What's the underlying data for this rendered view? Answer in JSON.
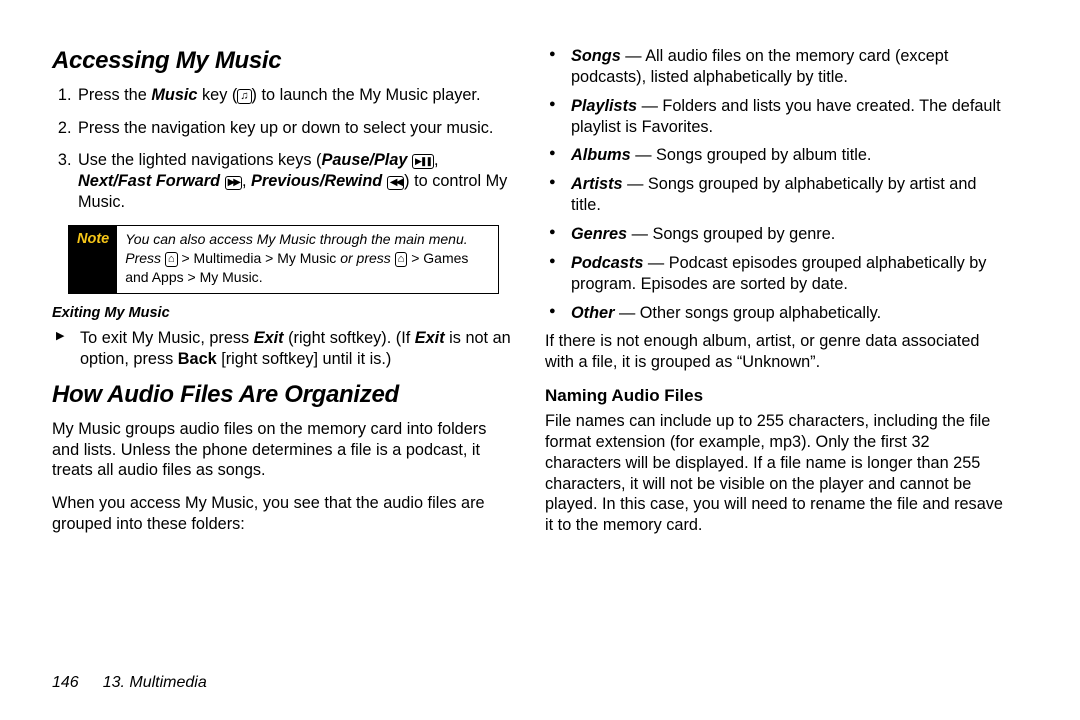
{
  "col1": {
    "h1": "Accessing My Music",
    "step1_a": "Press the ",
    "step1_b": "Music",
    "step1_c": " key (",
    "step1_d": ") to launch the My Music player.",
    "step2": "Press the navigation key up or down to select your music.",
    "step3_a": "Use the lighted navigations keys (",
    "step3_b": "Pause/Play",
    "step3_c": ", ",
    "step3_d": "Next/Fast Forward",
    "step3_e": ", ",
    "step3_f": "Previous/Rewind",
    "step3_g": ") to control My Music.",
    "note_label": "Note",
    "note_a": "You can also access My Music through the main menu. Press ",
    "note_b": " > ",
    "note_c": "Multimedia > My Music",
    "note_d": " or press ",
    "note_e": " > ",
    "note_f": "Games and Apps > My Music",
    "note_g": ".",
    "exit_h": "Exiting My Music",
    "exit_a": "To exit My Music, press ",
    "exit_b": "Exit",
    "exit_c": " (right softkey). (If ",
    "exit_d": "Exit",
    "exit_e": " is not an option, press ",
    "exit_f": "Back",
    "exit_g": " [right softkey] until it is.)",
    "h2": "How Audio Files Are Organized",
    "p1": "My Music groups audio files on the memory card into folders and lists. Unless the phone determines a file is a podcast, it treats all audio files as songs.",
    "p2": "When you access My Music, you see that the audio files are grouped into these folders:"
  },
  "col2": {
    "b1_a": "Songs",
    "b1_b": " — All audio files on the memory card (except podcasts), listed alphabetically by title.",
    "b2_a": "Playlists",
    "b2_b": " — Folders and lists you have created. The default playlist is Favorites.",
    "b3_a": "Albums",
    "b3_b": " — Songs grouped by album title.",
    "b4_a": "Artists",
    "b4_b": " — Songs grouped by alphabetically by artist and title.",
    "b5_a": "Genres",
    "b5_b": " — Songs grouped by genre.",
    "b6_a": "Podcasts",
    "b6_b": " — Podcast episodes grouped alphabetically by program. Episodes are sorted by date.",
    "b7_a": "Other",
    "b7_b": " — Other songs group alphabetically.",
    "p1": "If there is not enough album, artist, or genre data associated with a file, it is grouped as “Unknown”.",
    "h3": "Naming Audio Files",
    "p2": "File names can include up to 255 characters, including the file format extension (for example, mp3). Only the first 32 characters will be displayed. If a file name is longer than 255 characters, it will not be visible on the player and cannot be played. In this case, you will need to rename the file and resave it to the memory card."
  },
  "footer": {
    "page": "146",
    "chapter": "13. Multimedia"
  }
}
